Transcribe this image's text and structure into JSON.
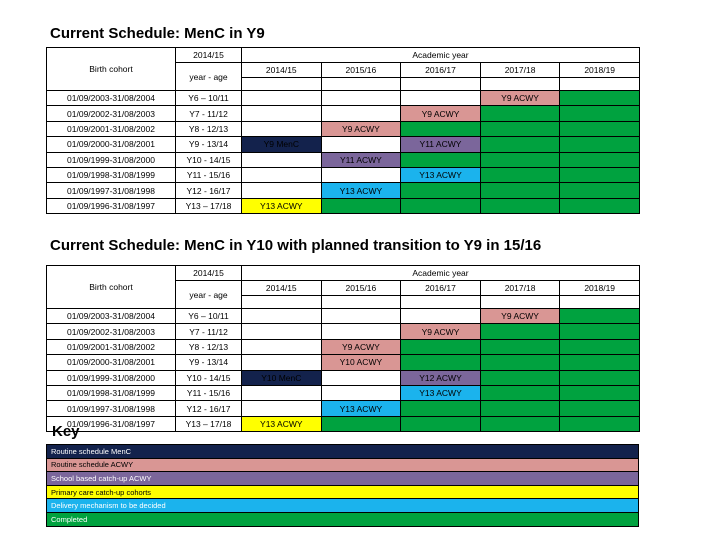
{
  "slide": {
    "key_heading": "Key"
  },
  "tables": [
    {
      "title": "Current Schedule: MenC in Y9",
      "headers": {
        "cohort": "Birth cohort",
        "yearage_top": "2014/15",
        "yearage_bottom": "year - age",
        "academic_year": "Academic year",
        "years": [
          "2014/15",
          "2015/16",
          "2016/17",
          "2017/18",
          "2018/19"
        ]
      },
      "rows": [
        {
          "cohort": "01/09/2003-31/08/2004",
          "yearage": "Y6 – 10/11",
          "cells": [
            {
              "label": "",
              "fill": "white"
            },
            {
              "label": "",
              "fill": "white"
            },
            {
              "label": "",
              "fill": "white"
            },
            {
              "label": "Y9 ACWY",
              "fill": "pink"
            },
            {
              "label": "",
              "fill": "green"
            }
          ]
        },
        {
          "cohort": "01/09/2002-31/08/2003",
          "yearage": "Y7 - 11/12",
          "cells": [
            {
              "label": "",
              "fill": "white"
            },
            {
              "label": "",
              "fill": "white"
            },
            {
              "label": "Y9 ACWY",
              "fill": "pink"
            },
            {
              "label": "",
              "fill": "green"
            },
            {
              "label": "",
              "fill": "green"
            }
          ]
        },
        {
          "cohort": "01/09/2001-31/08/2002",
          "yearage": "Y8 - 12/13",
          "cells": [
            {
              "label": "",
              "fill": "white"
            },
            {
              "label": "Y9 ACWY",
              "fill": "pink"
            },
            {
              "label": "",
              "fill": "green"
            },
            {
              "label": "",
              "fill": "green"
            },
            {
              "label": "",
              "fill": "green"
            }
          ]
        },
        {
          "cohort": "01/09/2000-31/08/2001",
          "yearage": "Y9 - 13/14",
          "cells": [
            {
              "label": "Y9 MenC",
              "fill": "navy"
            },
            {
              "label": "",
              "fill": "white"
            },
            {
              "label": "Y11 ACWY",
              "fill": "purple"
            },
            {
              "label": "",
              "fill": "green"
            },
            {
              "label": "",
              "fill": "green"
            }
          ]
        },
        {
          "cohort": "01/09/1999-31/08/2000",
          "yearage": "Y10 - 14/15",
          "cells": [
            {
              "label": "",
              "fill": "white"
            },
            {
              "label": "Y11 ACWY",
              "fill": "purple"
            },
            {
              "label": "",
              "fill": "green"
            },
            {
              "label": "",
              "fill": "green"
            },
            {
              "label": "",
              "fill": "green"
            }
          ]
        },
        {
          "cohort": "01/09/1998-31/08/1999",
          "yearage": "Y11 - 15/16",
          "cells": [
            {
              "label": "",
              "fill": "white"
            },
            {
              "label": "",
              "fill": "white"
            },
            {
              "label": "Y13 ACWY",
              "fill": "blue"
            },
            {
              "label": "",
              "fill": "green"
            },
            {
              "label": "",
              "fill": "green"
            }
          ]
        },
        {
          "cohort": "01/09/1997-31/08/1998",
          "yearage": "Y12 - 16/17",
          "cells": [
            {
              "label": "",
              "fill": "white"
            },
            {
              "label": "Y13 ACWY",
              "fill": "blue"
            },
            {
              "label": "",
              "fill": "green"
            },
            {
              "label": "",
              "fill": "green"
            },
            {
              "label": "",
              "fill": "green"
            }
          ]
        },
        {
          "cohort": "01/09/1996-31/08/1997",
          "yearage": "Y13 – 17/18",
          "cells": [
            {
              "label": "Y13 ACWY",
              "fill": "yellow"
            },
            {
              "label": "",
              "fill": "green"
            },
            {
              "label": "",
              "fill": "green"
            },
            {
              "label": "",
              "fill": "green"
            },
            {
              "label": "",
              "fill": "green"
            }
          ]
        }
      ]
    },
    {
      "title": "Current Schedule: MenC in Y10 with planned transition to Y9 in 15/16",
      "headers": {
        "cohort": "Birth cohort",
        "yearage_top": "2014/15",
        "yearage_bottom": "year - age",
        "academic_year": "Academic year",
        "years": [
          "2014/15",
          "2015/16",
          "2016/17",
          "2017/18",
          "2018/19"
        ]
      },
      "rows": [
        {
          "cohort": "01/09/2003-31/08/2004",
          "yearage": "Y6 – 10/11",
          "cells": [
            {
              "label": "",
              "fill": "white"
            },
            {
              "label": "",
              "fill": "white"
            },
            {
              "label": "",
              "fill": "white"
            },
            {
              "label": "Y9 ACWY",
              "fill": "pink"
            },
            {
              "label": "",
              "fill": "green"
            }
          ]
        },
        {
          "cohort": "01/09/2002-31/08/2003",
          "yearage": "Y7 - 11/12",
          "cells": [
            {
              "label": "",
              "fill": "white"
            },
            {
              "label": "",
              "fill": "white"
            },
            {
              "label": "Y9 ACWY",
              "fill": "pink"
            },
            {
              "label": "",
              "fill": "green"
            },
            {
              "label": "",
              "fill": "green"
            }
          ]
        },
        {
          "cohort": "01/09/2001-31/08/2002",
          "yearage": "Y8 - 12/13",
          "cells": [
            {
              "label": "",
              "fill": "white"
            },
            {
              "label": "Y9 ACWY",
              "fill": "pink"
            },
            {
              "label": "",
              "fill": "green"
            },
            {
              "label": "",
              "fill": "green"
            },
            {
              "label": "",
              "fill": "green"
            }
          ]
        },
        {
          "cohort": "01/09/2000-31/08/2001",
          "yearage": "Y9 - 13/14",
          "cells": [
            {
              "label": "",
              "fill": "white"
            },
            {
              "label": "Y10 ACWY",
              "fill": "pink"
            },
            {
              "label": "",
              "fill": "green"
            },
            {
              "label": "",
              "fill": "green"
            },
            {
              "label": "",
              "fill": "green"
            }
          ]
        },
        {
          "cohort": "01/09/1999-31/08/2000",
          "yearage": "Y10 - 14/15",
          "cells": [
            {
              "label": "Y10 MenC",
              "fill": "navy"
            },
            {
              "label": "",
              "fill": "white"
            },
            {
              "label": "Y12 ACWY",
              "fill": "purple"
            },
            {
              "label": "",
              "fill": "green"
            },
            {
              "label": "",
              "fill": "green"
            }
          ]
        },
        {
          "cohort": "01/09/1998-31/08/1999",
          "yearage": "Y11 - 15/16",
          "cells": [
            {
              "label": "",
              "fill": "white"
            },
            {
              "label": "",
              "fill": "white"
            },
            {
              "label": "Y13 ACWY",
              "fill": "blue"
            },
            {
              "label": "",
              "fill": "green"
            },
            {
              "label": "",
              "fill": "green"
            }
          ]
        },
        {
          "cohort": "01/09/1997-31/08/1998",
          "yearage": "Y12 - 16/17",
          "cells": [
            {
              "label": "",
              "fill": "white"
            },
            {
              "label": "Y13 ACWY",
              "fill": "blue"
            },
            {
              "label": "",
              "fill": "green"
            },
            {
              "label": "",
              "fill": "green"
            },
            {
              "label": "",
              "fill": "green"
            }
          ]
        },
        {
          "cohort": "01/09/1996-31/08/1997",
          "yearage": "Y13 – 17/18",
          "cells": [
            {
              "label": "Y13 ACWY",
              "fill": "yellow"
            },
            {
              "label": "",
              "fill": "green"
            },
            {
              "label": "",
              "fill": "green"
            },
            {
              "label": "",
              "fill": "green"
            },
            {
              "label": "",
              "fill": "green"
            }
          ]
        }
      ]
    }
  ],
  "key": [
    {
      "label": "Routine schedule MenC",
      "fill": "navy"
    },
    {
      "label": "Routine schedule ACWY",
      "fill": "pink"
    },
    {
      "label": "School based catch-up ACWY",
      "fill": "purple"
    },
    {
      "label": "Primary care catch-up cohorts",
      "fill": "yellow"
    },
    {
      "label": "Delivery mechanism to be decided",
      "fill": "blue"
    },
    {
      "label": "Completed",
      "fill": "green"
    }
  ],
  "colors": {
    "navy": "#13224c",
    "pink": "#d99694",
    "purple": "#7b669b",
    "yellow": "#ffff00",
    "blue": "#1bb3ed",
    "green": "#00a23f",
    "white": "#ffffff"
  }
}
